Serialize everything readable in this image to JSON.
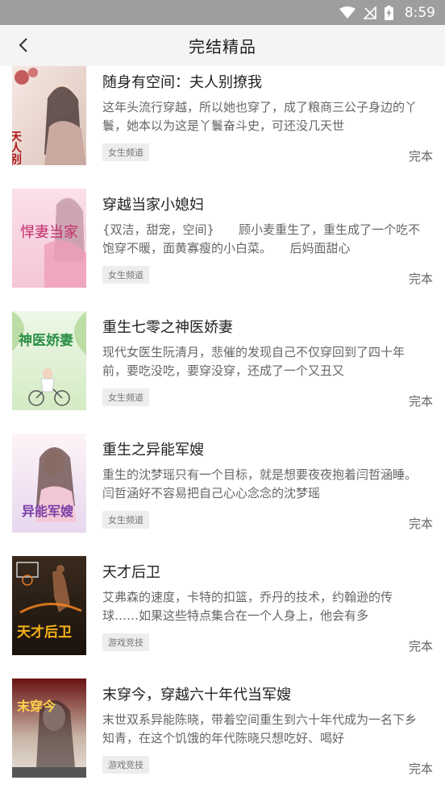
{
  "status_bar": {
    "time": "8:59"
  },
  "header": {
    "title": "完结精品"
  },
  "books": [
    {
      "title": "随身有空间：夫人别撩我",
      "desc": "这年头流行穿越，所以她也穿了，成了粮商三公子身边的丫鬟，她本以为这是丫鬟奋斗史，可还没几天世",
      "tag": "女生频道",
      "status": "完本",
      "cover_text": "天人别撩我"
    },
    {
      "title": "穿越当家小媳妇",
      "desc": "{双洁，甜宠，空间}　　顾小麦重生了，重生成了一个吃不饱穿不暖，面黄寡瘦的小白菜。　　后妈面甜心",
      "tag": "女生频道",
      "status": "完本",
      "cover_text": "悍妻当家"
    },
    {
      "title": "重生七零之神医娇妻",
      "desc": "现代女医生阮清月，悲催的发现自己不仅穿回到了四十年前，要吃没吃，要穿没穿，还成了一个又丑又",
      "tag": "女生频道",
      "status": "完本",
      "cover_text": "神医娇妻"
    },
    {
      "title": "重生之异能军嫂",
      "desc": "重生的沈梦瑶只有一个目标，就是想要夜夜抱着闫哲涵睡。　　闫哲涵好不容易把自己心心念念的沈梦瑶",
      "tag": "女生频道",
      "status": "完本",
      "cover_text": "异能军嫂"
    },
    {
      "title": "天才后卫",
      "desc": "艾弗森的速度，卡特的扣篮，乔丹的技术，约翰逊的传球……如果这些特点集合在一个人身上，他会有多",
      "tag": "游戏竞技",
      "status": "完本",
      "cover_text": "天才后卫"
    },
    {
      "title": "末穿今，穿越六十年代当军嫂",
      "desc": "末世双系异能陈晓，带着空间重生到六十年代成为一名下乡知青，在这个饥饿的年代陈晓只想吃好、喝好",
      "tag": "游戏竞技",
      "status": "完本",
      "cover_text": "末穿今"
    }
  ]
}
